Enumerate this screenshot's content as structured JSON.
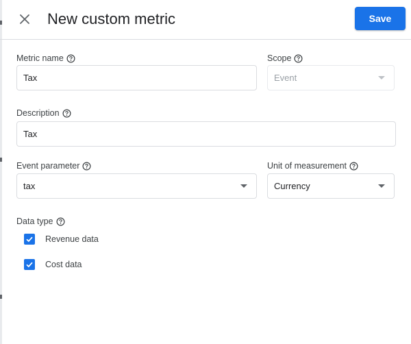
{
  "header": {
    "title": "New custom metric",
    "save_label": "Save"
  },
  "form": {
    "metric_name": {
      "label": "Metric name",
      "value": "Tax"
    },
    "scope": {
      "label": "Scope",
      "value": "Event"
    },
    "description": {
      "label": "Description",
      "value": "Tax"
    },
    "event_parameter": {
      "label": "Event parameter",
      "value": "tax"
    },
    "unit_of_measurement": {
      "label": "Unit of measurement",
      "value": "Currency"
    },
    "data_type": {
      "label": "Data type",
      "options": [
        {
          "label": "Revenue data",
          "checked": true
        },
        {
          "label": "Cost data",
          "checked": true
        }
      ]
    }
  },
  "colors": {
    "accent": "#1a73e8",
    "border": "#dadce0",
    "disabled_text": "#9aa0a6"
  }
}
